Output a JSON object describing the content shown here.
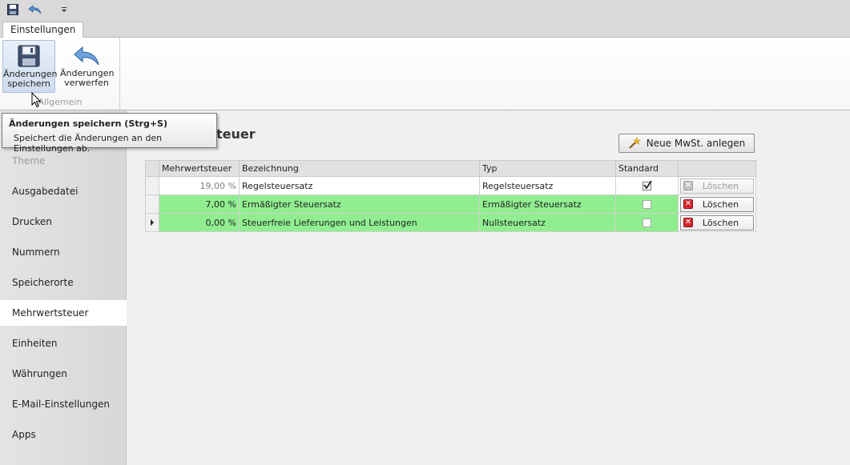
{
  "quick_access": {
    "save_icon": "floppy-disk-icon",
    "undo_icon": "undo-arrow-icon",
    "customize_icon": "dropdown-arrow-icon"
  },
  "tabs": [
    {
      "label": "Einstellungen"
    }
  ],
  "ribbon": {
    "group_label": "Allgemein",
    "save_button": {
      "line1": "Änderungen",
      "line2": "speichern",
      "icon": "floppy-disk-icon"
    },
    "discard_button": {
      "line1": "Änderungen",
      "line2": "verwerfen",
      "icon": "undo-arrow-icon"
    }
  },
  "tooltip": {
    "title": "Änderungen speichern (Strg+S)",
    "description": "Speichert die Änderungen an den Einstellungen ab."
  },
  "sidebar": {
    "items": [
      {
        "label": "Theme"
      },
      {
        "label": "Ausgabedatei"
      },
      {
        "label": "Drucken"
      },
      {
        "label": "Nummern"
      },
      {
        "label": "Speicherorte"
      },
      {
        "label": "Mehrwertsteuer"
      },
      {
        "label": "Einheiten"
      },
      {
        "label": "Währungen"
      },
      {
        "label": "E-Mail-Einstellungen"
      },
      {
        "label": "Apps"
      }
    ],
    "active": "Mehrwertsteuer"
  },
  "main": {
    "title_visible": "teuer",
    "new_button_label": "Neue MwSt. anlegen",
    "new_button_icon": "wand-star-icon",
    "columns": [
      "Mehrwertsteuer",
      "Bezeichnung",
      "Typ",
      "Standard"
    ],
    "rows": [
      {
        "rate": "19,00 %",
        "name": "Regelsteuersatz",
        "type": "Regelsteuersatz",
        "standard": true,
        "delete_label": "Löschen",
        "delete_enabled": false,
        "highlight": false,
        "current": false
      },
      {
        "rate": "7,00 %",
        "name": "Ermäßigter Steuersatz",
        "type": "Ermäßigter Steuersatz",
        "standard": false,
        "delete_label": "Löschen",
        "delete_enabled": true,
        "highlight": true,
        "current": false
      },
      {
        "rate": "0,00 %",
        "name": "Steuerfreie Lieferungen und Leistungen",
        "type": "Nullsteuersatz",
        "standard": false,
        "delete_label": "Löschen",
        "delete_enabled": true,
        "highlight": true,
        "current": true
      }
    ]
  },
  "colors": {
    "highlight_row": "#90ee90",
    "delete_icon": "#d9262c",
    "active_nav": "#ffffff"
  }
}
